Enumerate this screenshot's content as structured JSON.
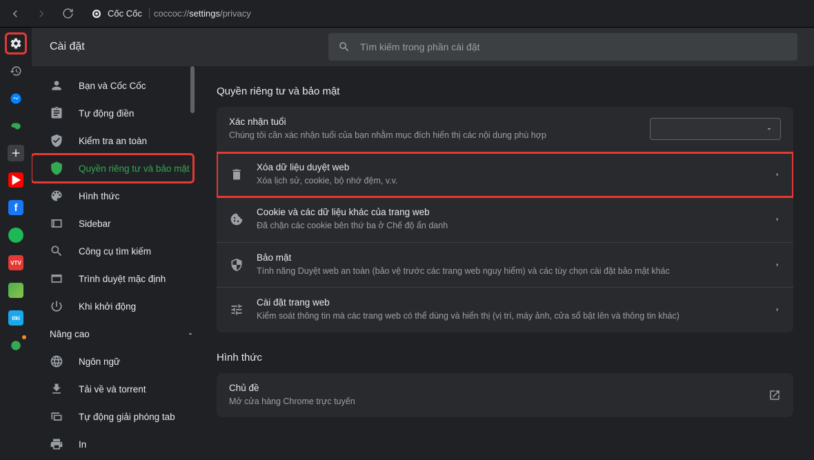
{
  "toolbar": {
    "site_name": "Cốc Cốc",
    "url_prefix": "coccoc://",
    "url_path": "settings",
    "url_tail": "/privacy"
  },
  "header": {
    "title": "Cài đặt",
    "search_placeholder": "Tìm kiếm trong phần cài đặt"
  },
  "sidebar": {
    "items": [
      {
        "label": "Bạn và Cốc Cốc"
      },
      {
        "label": "Tự động điền"
      },
      {
        "label": "Kiểm tra an toàn"
      },
      {
        "label": "Quyền riêng tư và bảo mật"
      },
      {
        "label": "Hình thức"
      },
      {
        "label": "Sidebar"
      },
      {
        "label": "Công cụ tìm kiếm"
      },
      {
        "label": "Trình duyệt mặc định"
      },
      {
        "label": "Khi khởi động"
      }
    ],
    "advanced": "Nâng cao",
    "adv_items": [
      {
        "label": "Ngôn ngữ"
      },
      {
        "label": "Tải về và torrent"
      },
      {
        "label": "Tự động giải phóng tab"
      },
      {
        "label": "In"
      }
    ]
  },
  "main": {
    "sec1_title": "Quyền riêng tư và bảo mật",
    "age": {
      "title": "Xác nhận tuổi",
      "sub": "Chúng tôi cần xác nhận tuổi của bạn nhằm mục đích hiển thị các nội dung phù hợp"
    },
    "rows": [
      {
        "title": "Xóa dữ liệu duyệt web",
        "sub": "Xóa lịch sử, cookie, bộ nhớ đệm, v.v."
      },
      {
        "title": "Cookie và các dữ liệu khác của trang web",
        "sub": "Đã chặn các cookie bên thứ ba ở Chế độ ẩn danh"
      },
      {
        "title": "Bảo mật",
        "sub": "Tính năng Duyệt web an toàn (bảo vệ trước các trang web nguy hiểm) và các tùy chọn cài đặt bảo mật khác"
      },
      {
        "title": "Cài đặt trang web",
        "sub": "Kiểm soát thông tin mà các trang web có thể dùng và hiển thị (vị trí, máy ảnh, cửa sổ bật lên và thông tin khác)"
      }
    ],
    "sec2_title": "Hình thức",
    "theme": {
      "title": "Chủ đề",
      "sub": "Mở cửa hàng Chrome trực tuyến"
    }
  }
}
